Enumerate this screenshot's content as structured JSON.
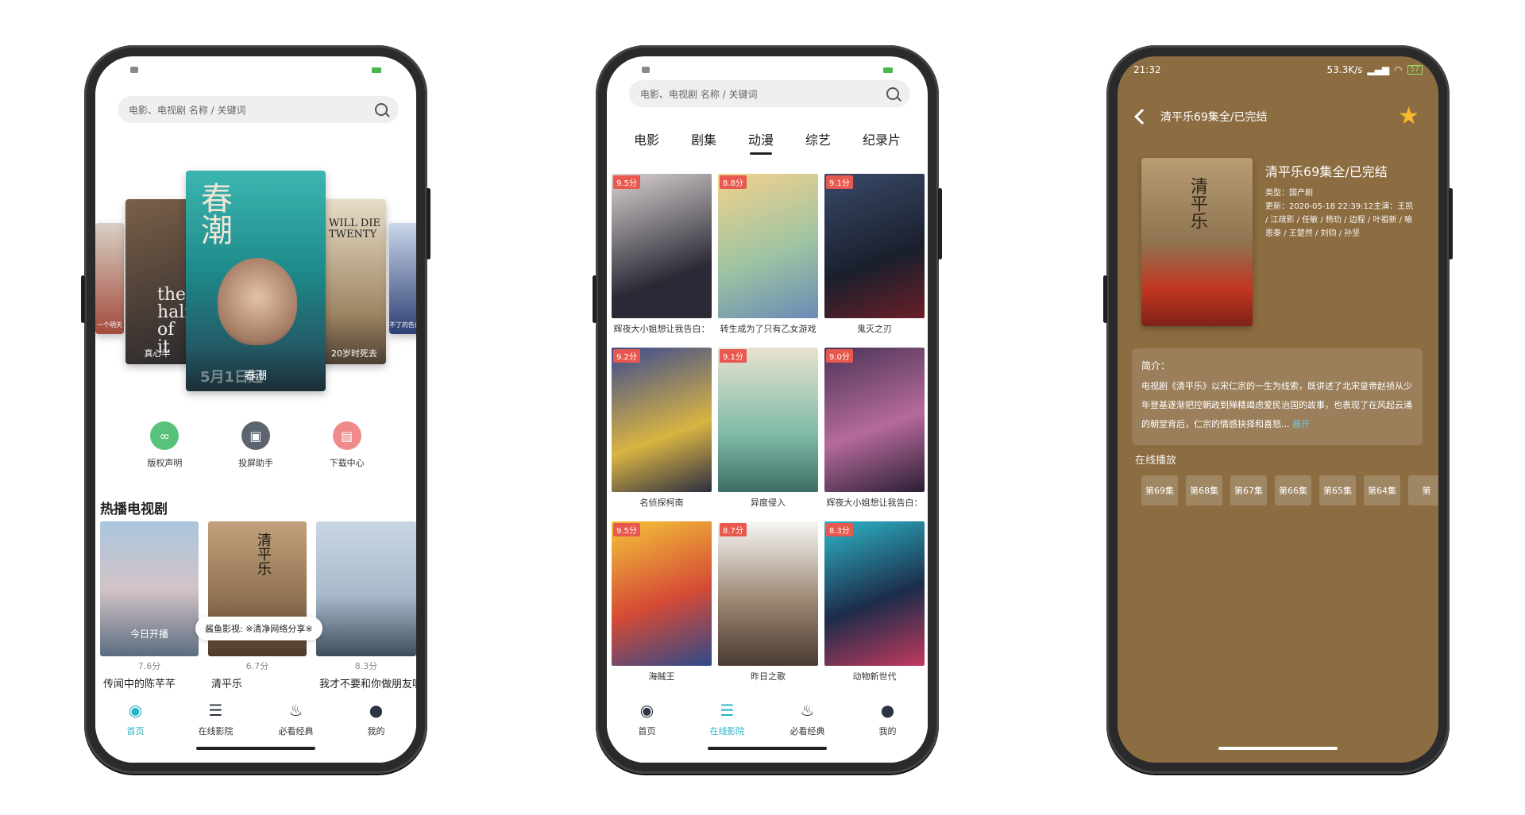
{
  "search": {
    "placeholder": "电影、电视剧 名称 / 关键词"
  },
  "phone1": {
    "carousel": {
      "left_far_caption": "一个明天",
      "left_caption": "真心半",
      "left_art": "the half of it",
      "center_caption": "春潮",
      "center_art": "春潮",
      "center_release": "5月1日起",
      "right_art": "WILL DIE TWENTY",
      "right_caption": "20岁时死去",
      "right_far_caption": "不了的告白"
    },
    "quick": [
      {
        "label": "版权声明",
        "icon": "infinity-icon"
      },
      {
        "label": "投屏助手",
        "icon": "cast-screen-icon"
      },
      {
        "label": "下载中心",
        "icon": "download-icon"
      }
    ],
    "section_title": "热播电视剧",
    "dramas": [
      {
        "score": "7.6分",
        "name": "传闻中的陈芊芊",
        "art": "今日开播"
      },
      {
        "score": "6.7分",
        "name": "清平乐",
        "art": "清平乐"
      },
      {
        "score": "8.3分",
        "name": "我才不要和你做朋友呢",
        "art": ""
      }
    ],
    "toast": "酱鱼影视: ※清净网络分享※"
  },
  "nav": [
    {
      "label": "首页",
      "icon": "home-icon"
    },
    {
      "label": "在线影院",
      "icon": "list-icon"
    },
    {
      "label": "必看经典",
      "icon": "flame-icon"
    },
    {
      "label": "我的",
      "icon": "user-icon"
    }
  ],
  "phone2": {
    "tabs": [
      "电影",
      "剧集",
      "动漫",
      "综艺",
      "纪录片"
    ],
    "grid": [
      {
        "score": "9.5分",
        "name": "辉夜大小姐想让我告白："
      },
      {
        "score": "8.8分",
        "name": "转生成为了只有乙女游戏"
      },
      {
        "score": "9.1分",
        "name": "鬼灭之刃"
      },
      {
        "score": "9.2分",
        "name": "名侦探柯南"
      },
      {
        "score": "9.1分",
        "name": "异度侵入"
      },
      {
        "score": "9.0分",
        "name": "辉夜大小姐想让我告白："
      },
      {
        "score": "9.5分",
        "name": "海贼王"
      },
      {
        "score": "8.7分",
        "name": "昨日之歌"
      },
      {
        "score": "8.3分",
        "name": "动物新世代"
      }
    ]
  },
  "phone3": {
    "time": "21:32",
    "net": "53.3K/s",
    "battery": "57",
    "header_title": "清平乐69集全/已完结",
    "title": "清平乐69集全/已完结",
    "type": "类型：国产剧",
    "update": "更新：2020-05-18 22:39:12主演：王凯 / 江疏影 / 任敏 / 杨玏 / 边程 / 叶祖新 / 喻恩泰 / 王楚然 / 刘钧 / 孙坚",
    "cover_art": "清平乐",
    "intro_label": "简介：",
    "intro": "电视剧《清平乐》以宋仁宗的一生为线索，既讲述了北宋皇帝赵祯从少年登基逐渐把控朝政到殚精竭虑爱民治国的故事，也表现了在风起云涌的朝堂背后，仁宗的情感抉择和喜怒...",
    "more": "展开",
    "play_label": "在线播放",
    "episodes": [
      "第69集",
      "第68集",
      "第67集",
      "第66集",
      "第65集",
      "第64集",
      "第"
    ]
  }
}
